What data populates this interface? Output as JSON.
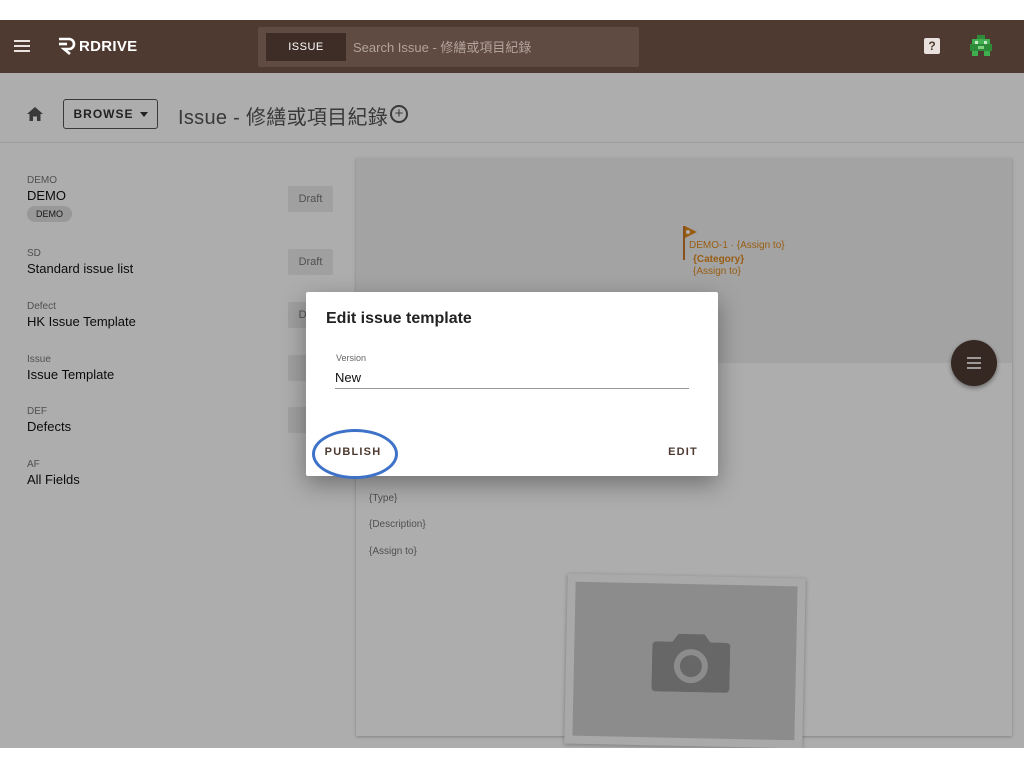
{
  "app": {
    "brand": "RDRIVE"
  },
  "search": {
    "scope": "ISSUE",
    "placeholder": "Search Issue - 修繕或項目紀錄"
  },
  "header": {
    "help_label": "?"
  },
  "toolbar": {
    "browse_label": "BROWSE",
    "title": "Issue - 修繕或項目紀錄"
  },
  "templates": [
    {
      "category": "DEMO",
      "title": "DEMO",
      "chip": "DEMO",
      "status": "Draft"
    },
    {
      "category": "SD",
      "title": "Standard issue list",
      "status": "Draft"
    },
    {
      "category": "Defect",
      "title": "HK Issue Template",
      "status": "Draft"
    },
    {
      "category": "Issue",
      "title": "Issue Template",
      "status": "D"
    },
    {
      "category": "DEF",
      "title": "Defects",
      "status": "D"
    },
    {
      "category": "AF",
      "title": "All Fields",
      "status": ""
    }
  ],
  "preview": {
    "pin_line1": "DEMO-1 · {Assign to}",
    "pin_line2": "{Category}",
    "pin_line3": "{Assign to}",
    "fields": [
      "{Type}",
      "{Description}",
      "{Assign to}"
    ]
  },
  "dialog": {
    "title": "Edit issue template",
    "version_label": "Version",
    "version_value": "New",
    "publish_label": "PUBLISH",
    "edit_label": "EDIT"
  },
  "colors": {
    "appbar": "#4e3a31",
    "accent": "#e08a1a",
    "highlight": "#3d72c8"
  }
}
